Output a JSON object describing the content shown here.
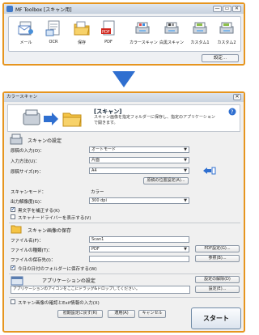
{
  "toolbox": {
    "title": "MF Toolbox [スキャン用]",
    "minimize": "—",
    "restore": "▭",
    "close": "✕",
    "buttons": [
      {
        "label": "メール",
        "icon": "mail-icon"
      },
      {
        "label": "OCR",
        "icon": "ocr-document-icon"
      },
      {
        "label": "保存",
        "icon": "save-folder-icon"
      },
      {
        "label": "PDF",
        "icon": "pdf-icon"
      },
      {
        "label": "カラースキャン",
        "icon": "color-scan-icon"
      },
      {
        "label": "白黒スキャン",
        "icon": "bw-scan-icon"
      },
      {
        "label": "カスタム1",
        "icon": "custom-scan-icon"
      },
      {
        "label": "カスタム2",
        "icon": "custom-scan-icon"
      }
    ],
    "settings_label": "設定..."
  },
  "dialog": {
    "title": "カラースキャン",
    "close": "✕",
    "header_title": "[スキャン]",
    "header_desc": "スキャン画像を指定フォルダーに保存し、指定のアプリケーションで開きます。",
    "scan_section": "スキャンの設定",
    "source_label": "原稿の入力(O)：",
    "source_value": "オートモード",
    "input_method_label": "入力方法(U)：",
    "input_method_value": "片面",
    "size_label": "原稿サイズ(P)：",
    "size_value": "A4",
    "area_btn": "原稿の位置設定(A)...",
    "mode_label": "スキャンモード：",
    "mode_value": "カラー",
    "resolution_label": "出力解像度(G)：",
    "resolution_value": "300 dpi",
    "skew_check": "黒文字を補正する(K)",
    "driver_check": "スキャナードライバーを表示する(V)",
    "save_section": "スキャン画像の保存",
    "filename_label": "ファイル名(F)：",
    "filename_value": "Scan1",
    "filetype_label": "ファイルの種類(T)：",
    "filetype_value": "PDF",
    "pdf_settings_btn": "PDF設定(G)...",
    "savepath_label": "ファイルの保存先(I)：",
    "browse_btn": "参照(B)...",
    "date_folder_check": "今日の日付のフォルダーに保存する(W)",
    "app_section": "アプリケーションの設定",
    "app_clear_btn": "設定の解除(D)",
    "app_drop_hint": "アプリケーションのアイコンをここにドラッグ&ドロップしてください。",
    "app_set_btn": "設定(E)...",
    "confirm_check": "スキャン画像の確認とExif情報の入力(X)",
    "defaults_btn": "初期設定に戻す(R)",
    "apply_btn": "適用(A)",
    "cancel_btn": "キャンセル",
    "start_btn": "スタート"
  },
  "colors": {
    "accent_orange": "#e6951f",
    "arrow_blue": "#2f6fd0"
  }
}
